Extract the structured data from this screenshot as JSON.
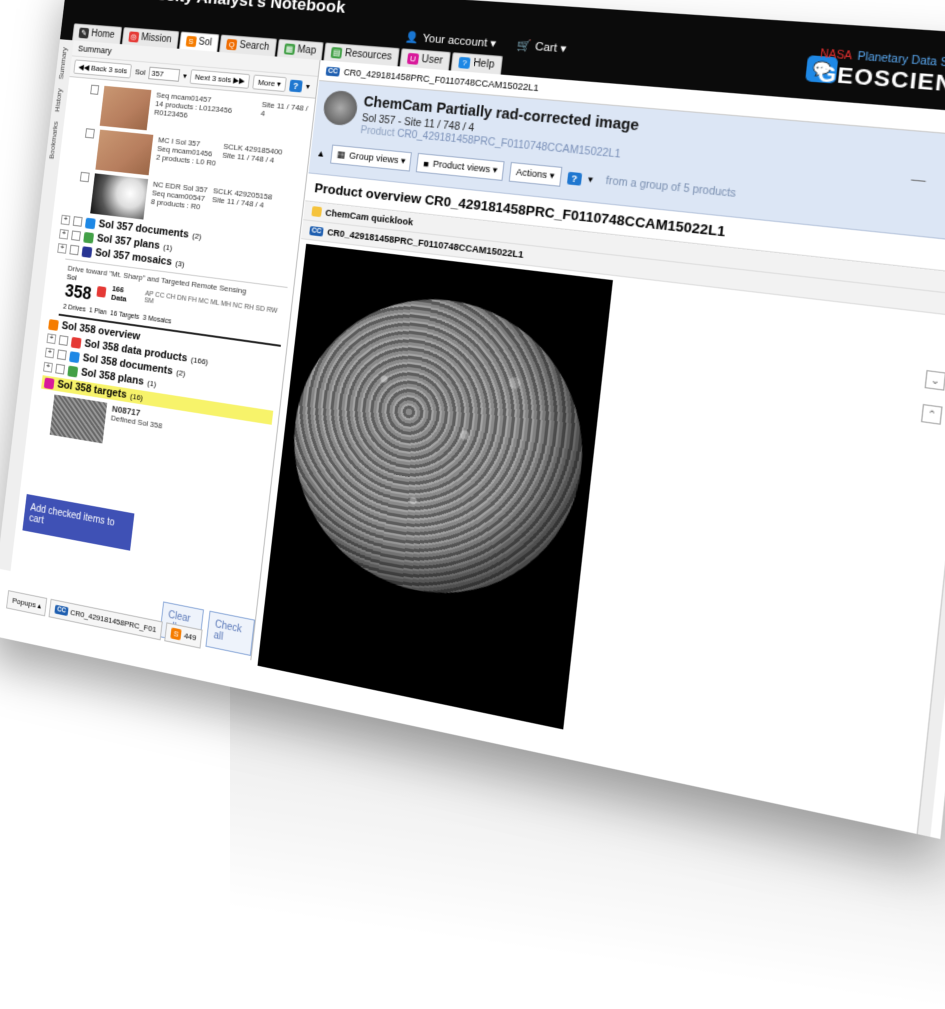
{
  "app": {
    "title": "MSL Curiosity Analyst's Notebook"
  },
  "tabs": [
    {
      "label": "Home",
      "color": "#333333"
    },
    {
      "label": "Mission",
      "color": "#e53935"
    },
    {
      "label": "Sol",
      "color": "#f57c00"
    },
    {
      "label": "Search",
      "color": "#ef6c00"
    },
    {
      "label": "Map",
      "color": "#43a047"
    },
    {
      "label": "Resources",
      "color": "#43a047"
    },
    {
      "label": "User",
      "color": "#d81b9b"
    },
    {
      "label": "Help",
      "color": "#1e88e5"
    }
  ],
  "account": {
    "your_account": "Your account ▾",
    "cart": "Cart ▾"
  },
  "branding": {
    "nasa": "NASA",
    "pds": "Planetary Data System",
    "geo": "GEOSCIENCES"
  },
  "sidetabs": [
    "Summary",
    "History",
    "Bookmarks"
  ],
  "left": {
    "summary_title": "Summary",
    "back_label": "◀◀ Back 3 sols",
    "sol_label": "Sol",
    "sol_value": "357",
    "next_label": "Next 3 sols ▶▶",
    "more_label": "More ▾",
    "help_label": "?",
    "products": [
      {
        "line1": "Seq mcam01457",
        "line2": "14 products : L0123456 R0123456",
        "site": "Site 11 / 748 / 4"
      },
      {
        "line1": "MC I     Sol 357",
        "line2": "Seq mcam01456",
        "line3": "2 products : L0 R0",
        "site": "SCLK 429185400",
        "site2": "Site 11 / 748 / 4"
      },
      {
        "line1": "NC EDR   Sol 357",
        "line2": "Seq ncam00547",
        "line3": "8 products : R0",
        "site": "SCLK 429205158",
        "site2": "Site 11 / 748 / 4"
      }
    ],
    "nodes357": [
      {
        "label": "Sol 357 documents",
        "count": "(2)"
      },
      {
        "label": "Sol 357 plans",
        "count": "(1)"
      },
      {
        "label": "Sol 357 mosaics",
        "count": "(3)"
      }
    ],
    "sol358": {
      "sol_word": "Sol",
      "number": "358",
      "drive": "Drive toward \"Mt. Sharp\" and Targeted Remote Sensing",
      "data": "166 Data",
      "instruments": "AP CC CH DN FH MC ML MH NC RH SD RW SM",
      "drives": "2 Drives",
      "plan": "1 Plan",
      "targets": "16 Targets",
      "mosaics": "3 Mosaics"
    },
    "nodes358": [
      {
        "label": "Sol 358 overview",
        "count": ""
      },
      {
        "label": "Sol 358 data products",
        "count": "(166)"
      },
      {
        "label": "Sol 358 documents",
        "count": "(2)"
      },
      {
        "label": "Sol 358 plans",
        "count": "(1)"
      },
      {
        "label": "Sol 358 targets",
        "count": "(16)"
      }
    ],
    "target": {
      "name": "N08717",
      "defined": "Defined Sol 358"
    },
    "add_cart": "Add checked items to cart",
    "clear_all": "Clear all",
    "check_all": "Check all",
    "popups": "Popups ▴",
    "popup_tab1": "CR0_429181458PRC_F01",
    "popup_tab2": "449"
  },
  "right": {
    "tab_label": "CR0_429181458PRC_F0110748CCAM15022L1",
    "title": "ChemCam Partially rad-corrected image",
    "subtitle": "Sol 357 - Site 11 / 748 / 4",
    "product_prefix": "Product",
    "product_id": "CR0_429181458PRC_F0110748CCAM15022L1",
    "group_of": "from a group of 5 products",
    "group_views": "Group views ▾",
    "product_views": "Product views ▾",
    "actions": "Actions ▾",
    "help_label": "?",
    "overview": "Product overview CR0_429181458PRC_F0110748CCAM15022L1",
    "quicklook": "ChemCam quicklook",
    "image_label": "CR0_429181458PRC_F0110748CCAM15022L1",
    "min": "—",
    "restore": "❐",
    "close": "✕"
  }
}
